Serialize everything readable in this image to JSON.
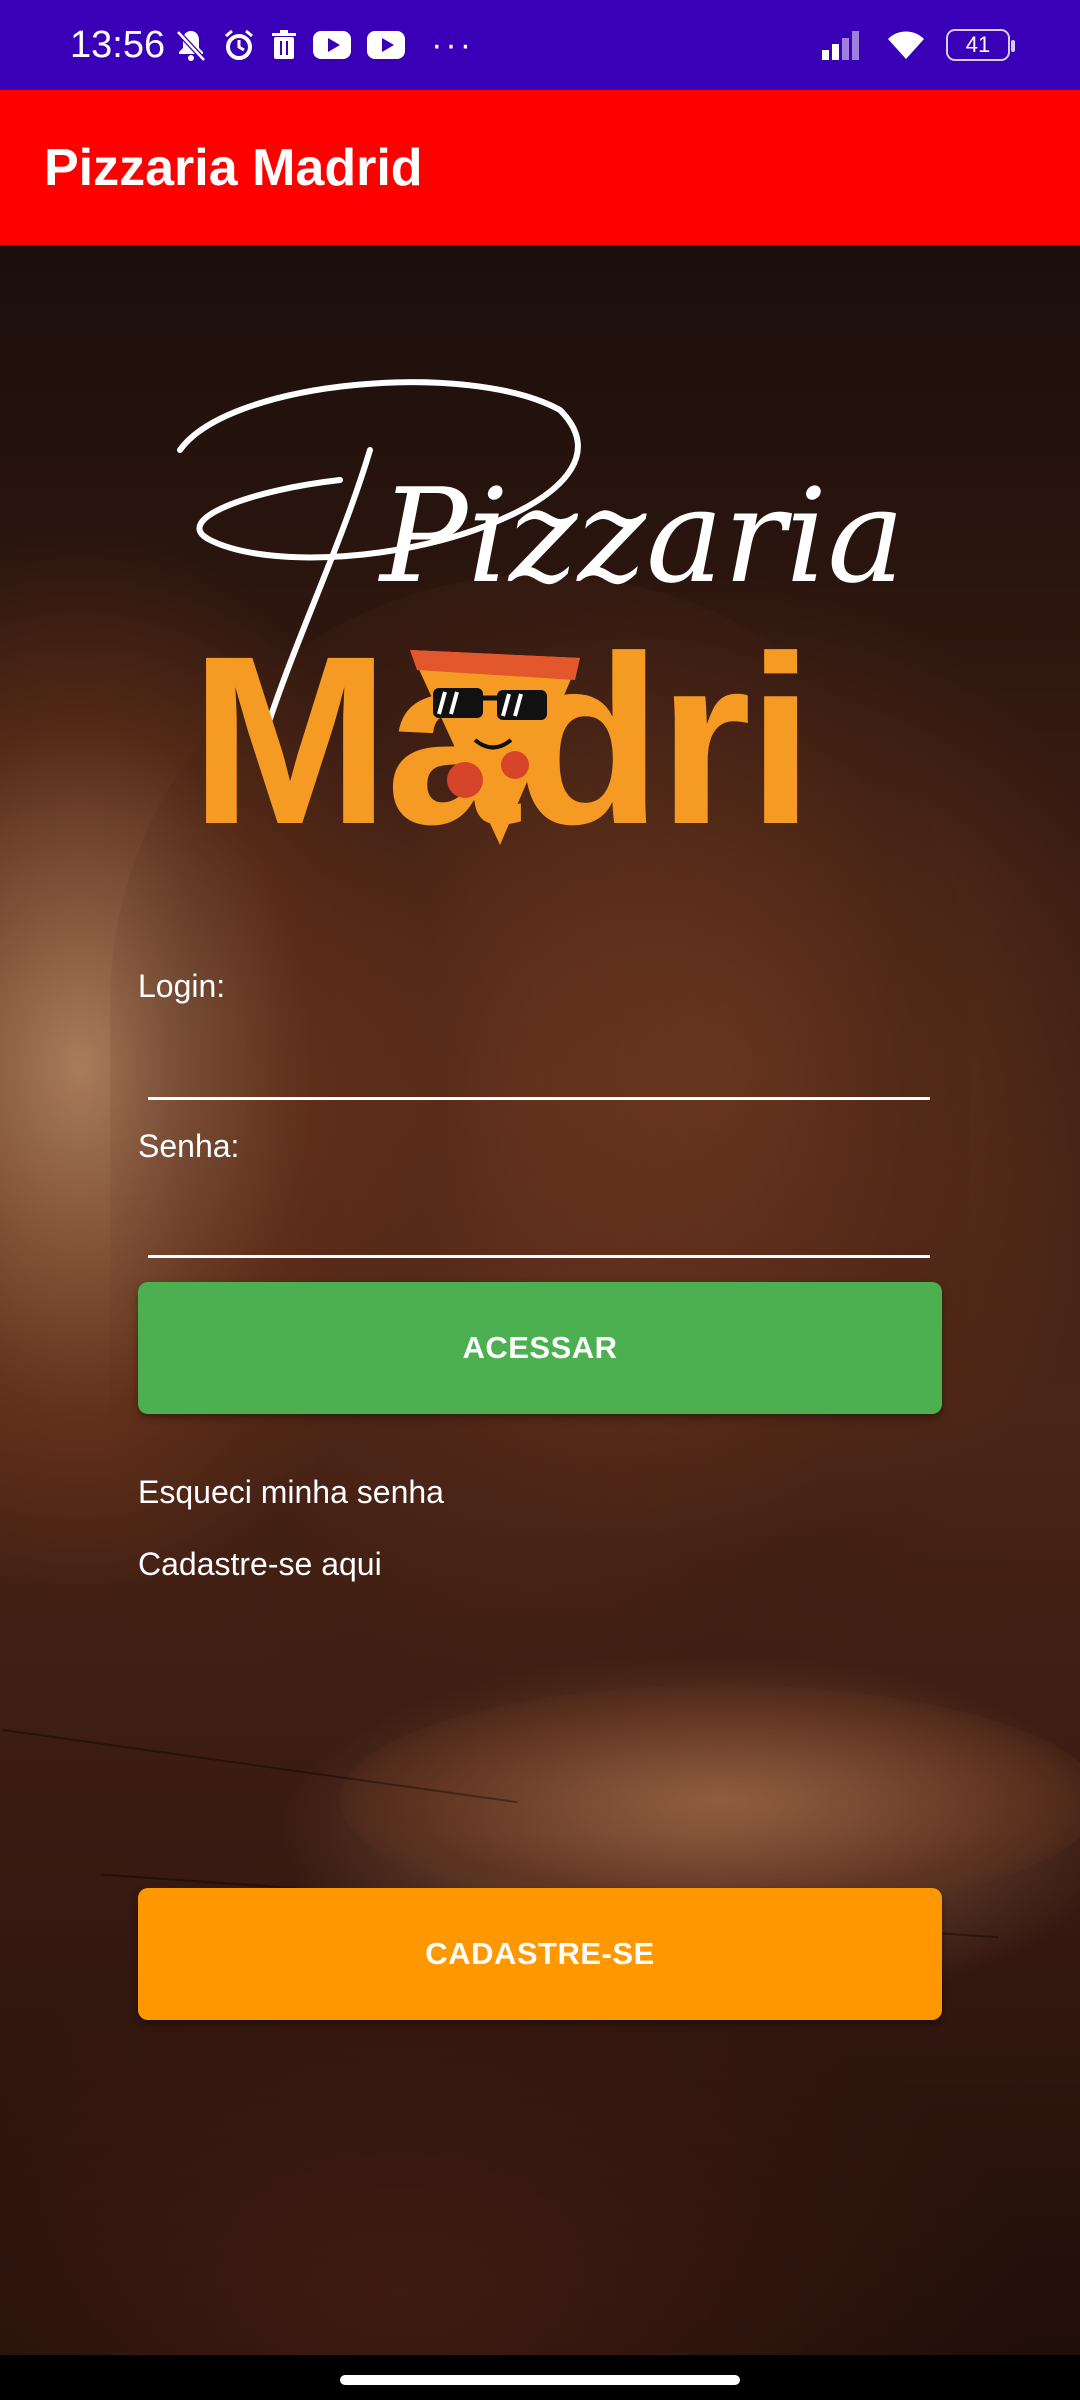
{
  "status_bar": {
    "time": "13:56",
    "battery": "41",
    "icons_left": [
      "mute-icon",
      "alarm-icon",
      "trash-icon",
      "youtube-icon",
      "youtube-icon",
      "more-dots-icon"
    ],
    "icons_right": [
      "signal-icon",
      "wifi-icon",
      "battery-icon"
    ],
    "background_color": "#3a00b8"
  },
  "app_bar": {
    "title": "Pizzaria Madrid",
    "background_color": "#ff0000"
  },
  "logo": {
    "script_text": "Pizzaria",
    "brand_text": "Madri",
    "brand_color": "#f59a23"
  },
  "form": {
    "login_label": "Login:",
    "login_value": "",
    "password_label": "Senha:",
    "password_value": "",
    "submit_label": "ACESSAR",
    "submit_color": "#4caf50"
  },
  "links": {
    "forgot_password": "Esqueci minha senha",
    "register_here": "Cadastre-se aqui"
  },
  "register_button": {
    "label": "CADASTRE-SE",
    "color": "#ff9800"
  }
}
